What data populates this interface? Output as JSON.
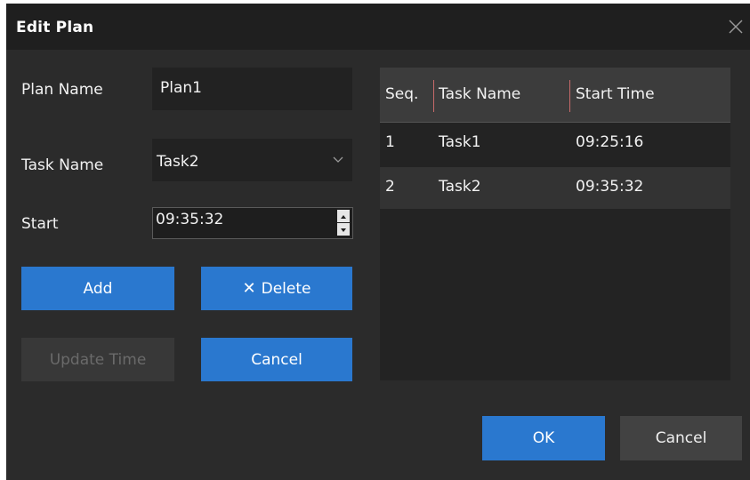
{
  "dialog": {
    "title": "Edit Plan"
  },
  "form": {
    "plan_name_label": "Plan Name",
    "plan_name_value": "Plan1",
    "task_name_label": "Task Name",
    "task_name_value": "Task2",
    "start_label": "Start",
    "start_value": "09:35:32"
  },
  "buttons": {
    "add": "Add",
    "delete": "Delete",
    "update_time": "Update Time",
    "cancel_inner": "Cancel",
    "ok": "OK",
    "cancel": "Cancel"
  },
  "table": {
    "columns": [
      "Seq.",
      "Task Name",
      "Start Time"
    ],
    "rows": [
      {
        "seq": "1",
        "task": "Task1",
        "time": "09:25:16"
      },
      {
        "seq": "2",
        "task": "Task2",
        "time": "09:35:32"
      }
    ]
  },
  "icons": {
    "close": "close-icon",
    "combo": "chevron-down-icon",
    "delete": "x-icon",
    "spin_up": "spin-up-icon",
    "spin_down": "spin-down-icon"
  },
  "colors": {
    "dialog_bg": "#2b2b2b",
    "titlebar_bg": "#1f1f1f",
    "primary_button": "#2a78cf",
    "secondary_button": "#424242",
    "disabled_button": "#383838",
    "table_bg": "#232323",
    "table_header_bg": "#3c3c3c",
    "selected_row_bg": "#333333",
    "column_separator": "#c86a6a"
  }
}
